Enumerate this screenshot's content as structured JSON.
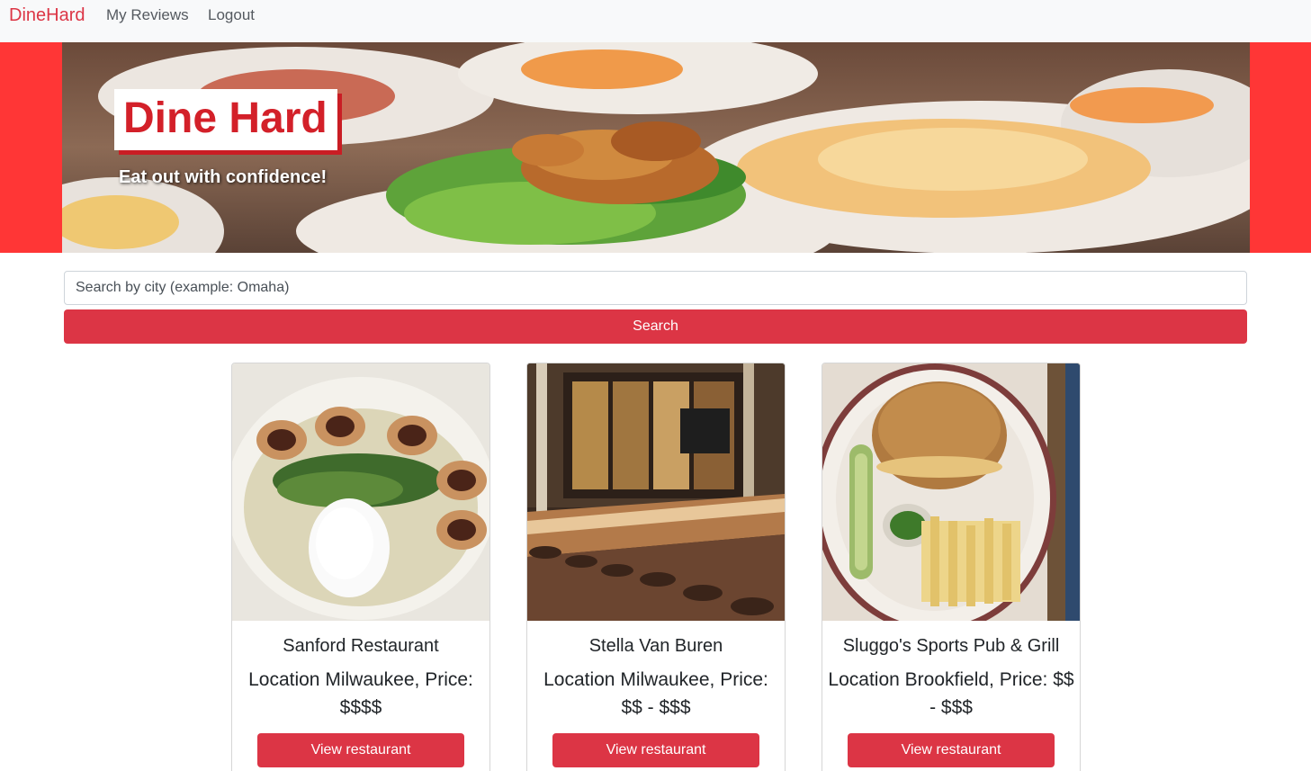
{
  "navbar": {
    "brand": "DineHard",
    "links": [
      {
        "label": "My Reviews"
      },
      {
        "label": "Logout"
      }
    ]
  },
  "hero": {
    "title": "Dine Hard",
    "subtitle": "Eat out with confidence!"
  },
  "search": {
    "placeholder": "Search by city (example: Omaha)",
    "value": "",
    "button_label": "Search"
  },
  "restaurants": [
    {
      "name": "Sanford Restaurant",
      "details": "Location Milwaukee, Price: $$$$",
      "button_label": "View restaurant"
    },
    {
      "name": "Stella Van Buren",
      "details": "Location Milwaukee, Price: $$ - $$$",
      "button_label": "View restaurant"
    },
    {
      "name": "Sluggo's Sports Pub & Grill",
      "details": "Location Brookfield, Price: $$ - $$$",
      "button_label": "View restaurant"
    }
  ],
  "colors": {
    "brand": "#dc3545",
    "hero_band": "#ff3636",
    "navbar_bg": "#f8f9fa"
  }
}
